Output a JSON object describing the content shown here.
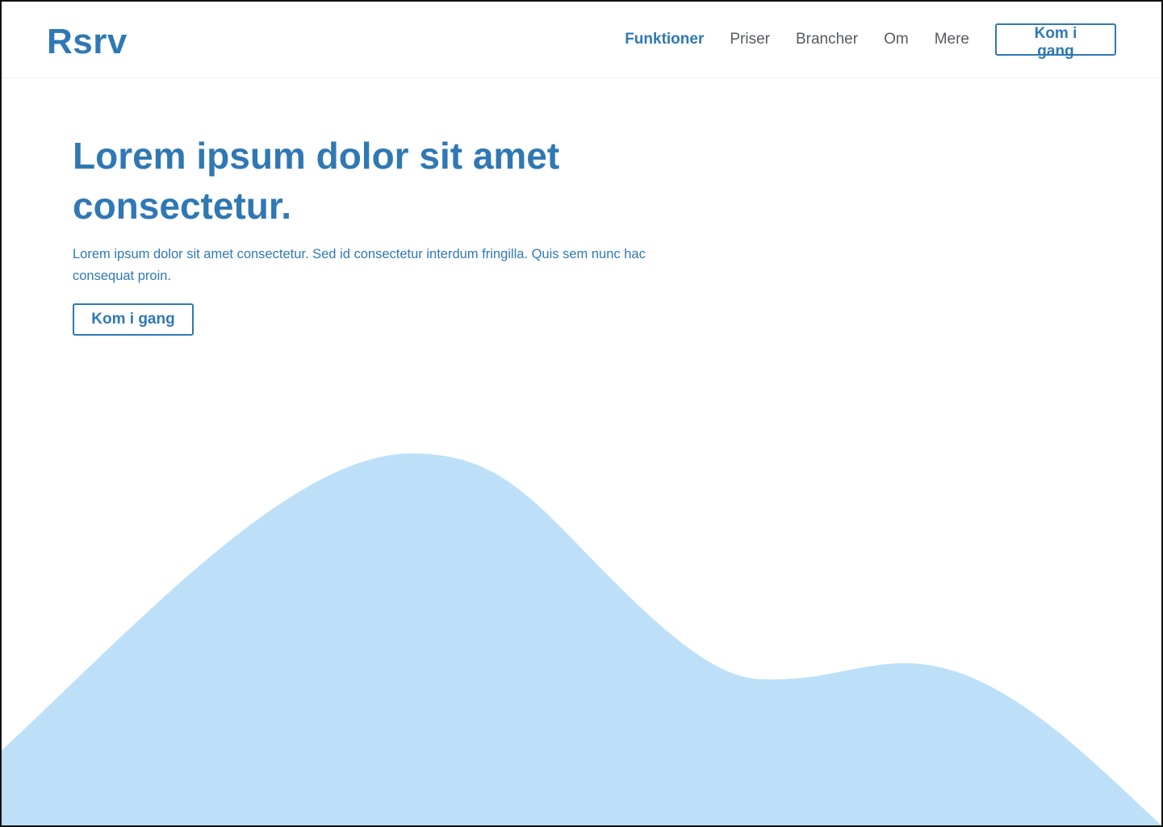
{
  "header": {
    "logo": "Rsrv",
    "nav": [
      {
        "label": "Funktioner",
        "active": true
      },
      {
        "label": "Priser",
        "active": false
      },
      {
        "label": "Brancher",
        "active": false
      },
      {
        "label": "Om",
        "active": false
      },
      {
        "label": "Mere",
        "active": false
      }
    ],
    "cta_label": "Kom i gang"
  },
  "hero": {
    "title": "Lorem ipsum dolor sit amet consectetur.",
    "text": "Lorem ipsum dolor sit amet consectetur. Sed id consectetur interdum fringilla. Quis sem nunc hac consequat proin.",
    "cta_label": "Kom i gang"
  },
  "colors": {
    "accent": "#2f78b4",
    "nav_text": "#555a61",
    "wave_fill": "#bde0f8",
    "frame_border": "#111111"
  }
}
